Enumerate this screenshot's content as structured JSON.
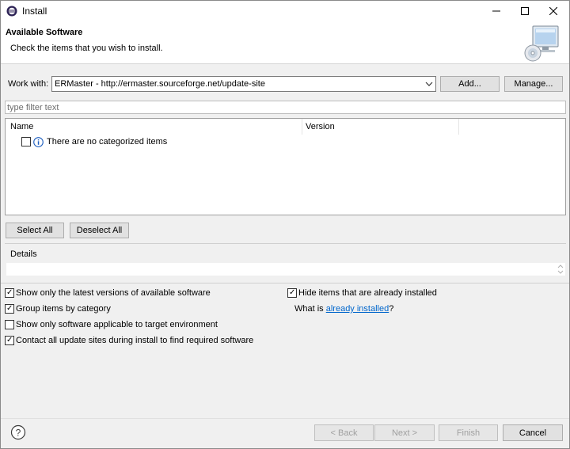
{
  "window": {
    "title": "Install",
    "app_icon": "eclipse-icon",
    "controls": [
      "minimize-icon",
      "maximize-icon",
      "close-icon"
    ]
  },
  "header": {
    "title": "Available Software",
    "subtitle": "Check the items that you wish to install.",
    "image": "install-software-banner-icon"
  },
  "work_with": {
    "label": "Work with:",
    "value": "ERMaster - http://ermaster.sourceforge.net/update-site",
    "add_label": "Add...",
    "manage_label": "Manage..."
  },
  "filter": {
    "placeholder": "type filter text"
  },
  "tree": {
    "columns": [
      "Name",
      "Version"
    ],
    "rows": [
      {
        "checked": false,
        "icon": "info-icon",
        "text": "There are no categorized items"
      }
    ]
  },
  "selection_buttons": {
    "select_all": "Select All",
    "deselect_all": "Deselect All"
  },
  "details": {
    "label": "Details",
    "text": ""
  },
  "options": {
    "latest_versions": {
      "label": "Show only the latest versions of available software",
      "checked": true
    },
    "group_by_category": {
      "label": "Group items by category",
      "checked": true
    },
    "target_env": {
      "label": "Show only software applicable to target environment",
      "checked": false
    },
    "contact_sites": {
      "label": "Contact all update sites during install to find required software",
      "checked": true
    },
    "hide_installed": {
      "label": "Hide items that are already installed",
      "checked": true
    },
    "what_is_prefix": "What is ",
    "what_is_link": "already installed",
    "what_is_suffix": "?"
  },
  "footer": {
    "help_icon": "help-icon",
    "back_label": "< Back",
    "next_label": "Next >",
    "finish_label": "Finish",
    "cancel_label": "Cancel"
  },
  "colors": {
    "link": "#0066cc",
    "disabled_text": "#a0a0a0",
    "dialog_bg": "#f0f0f0"
  }
}
